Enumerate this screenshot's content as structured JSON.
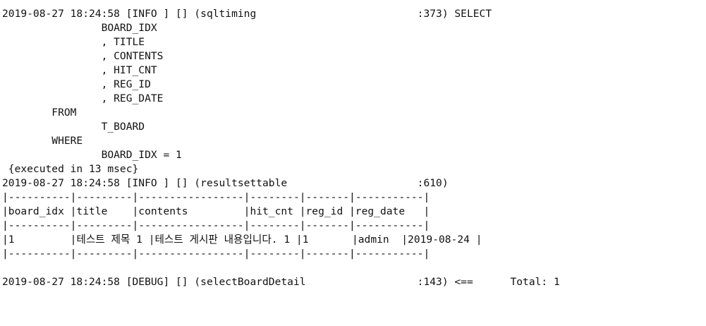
{
  "console": {
    "sql_log": {
      "header": "2019-08-27 18:24:58 [INFO ] [] (sqltiming                          :373) SELECT",
      "lines": [
        "                BOARD_IDX",
        "                , TITLE",
        "                , CONTENTS",
        "                , HIT_CNT",
        "                , REG_ID",
        "                , REG_DATE",
        "        FROM",
        "                T_BOARD",
        "        WHERE",
        "                BOARD_IDX = 1"
      ],
      "executed": " {executed in 13 msec}"
    },
    "result_log": {
      "header": "2019-08-27 18:24:58 [INFO ] [] (resultsettable                     :610)",
      "table_lines": [
        "|----------|---------|-----------------|--------|-------|-----------|",
        "|board_idx |title    |contents         |hit_cnt |reg_id |reg_date   |",
        "|----------|---------|-----------------|--------|-------|-----------|",
        "|1         |테스트 제목 1 |테스트 게시판 내용입니다. 1 |1       |admin  |2019-08-24 |",
        "|----------|---------|-----------------|--------|-------|-----------|"
      ]
    },
    "debug_log": {
      "line": "2019-08-27 18:24:58 [DEBUG] [] (selectBoardDetail                  :143) <==      Total: 1"
    }
  }
}
